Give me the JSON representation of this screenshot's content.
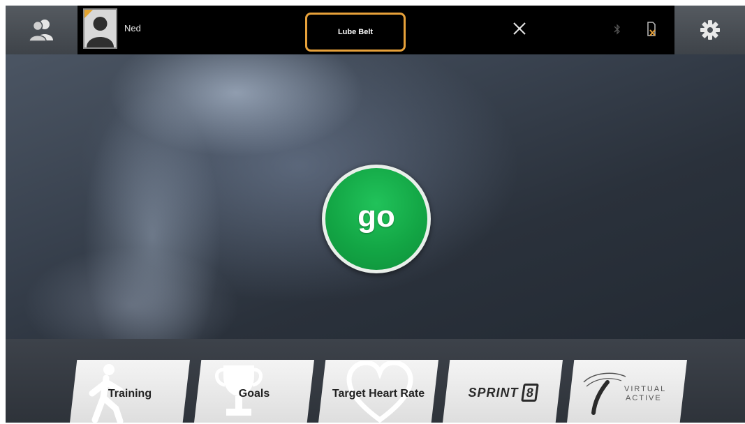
{
  "topbar": {
    "user_name": "Ned",
    "notice_label": "Lube Belt",
    "icons": {
      "switch_user": "users-icon",
      "settings": "gear-icon",
      "close": "close-icon",
      "bluetooth": "bluetooth-icon",
      "sd_card": "sd-card-warning-icon"
    }
  },
  "hero": {
    "go_label": "go"
  },
  "tiles": [
    {
      "label": "Training",
      "icon": "walking-person-icon"
    },
    {
      "label": "Goals",
      "icon": "trophy-icon"
    },
    {
      "label": "Target Heart Rate",
      "icon": "heart-icon"
    },
    {
      "label": "SPRINT",
      "badge": "8",
      "icon": "sprint8-logo"
    },
    {
      "label_line1": "VIRTUAL",
      "label_line2": "ACTIVE",
      "icon": "virtual-active-logo"
    }
  ],
  "colors": {
    "accent_orange": "#e7a13a",
    "go_green": "#13a645",
    "topbar_black": "#000000"
  }
}
